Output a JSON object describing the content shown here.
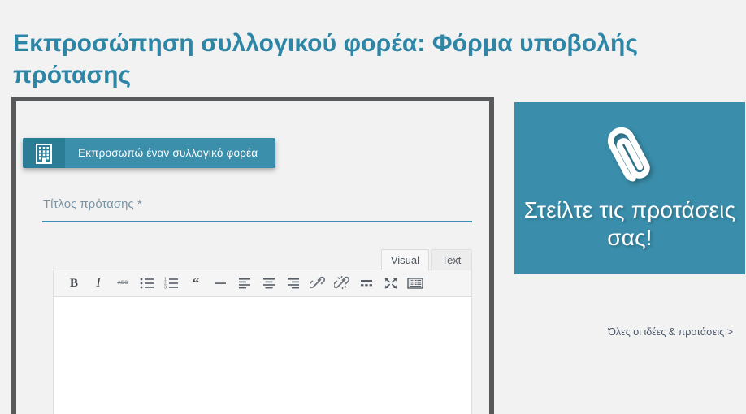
{
  "page": {
    "title": "Εκπροσώπηση συλλογικού φορέα: Φόρμα υποβολής πρότασης",
    "background_color": "#f2f2f2",
    "accent_color": "#3a8eab",
    "title_color": "#2e86a6"
  },
  "form": {
    "border_color": "#58595b",
    "tab": {
      "label": "Εκπροσωπώ έναν συλλογικό φορέα",
      "icon": "building-icon",
      "icon_cell_color": "#2b7c95",
      "label_cell_color": "#3c8fab",
      "selected": true
    },
    "title_input": {
      "placeholder": "Τίτλος πρότασης *",
      "value": "",
      "underline_color": "#3c8fab"
    },
    "editor": {
      "tabs": [
        {
          "label": "Visual",
          "active": true
        },
        {
          "label": "Text",
          "active": false
        }
      ],
      "toolbar": [
        {
          "name": "bold-icon",
          "label": "B"
        },
        {
          "name": "italic-icon",
          "label": "I"
        },
        {
          "name": "strikethrough-icon",
          "label": "ABC"
        },
        {
          "name": "bulleted-list-icon",
          "label": ""
        },
        {
          "name": "numbered-list-icon",
          "label": ""
        },
        {
          "name": "blockquote-icon",
          "label": ""
        },
        {
          "name": "horizontal-rule-icon",
          "label": ""
        },
        {
          "name": "align-left-icon",
          "label": ""
        },
        {
          "name": "align-center-icon",
          "label": ""
        },
        {
          "name": "align-right-icon",
          "label": ""
        },
        {
          "name": "insert-link-icon",
          "label": ""
        },
        {
          "name": "remove-link-icon",
          "label": ""
        },
        {
          "name": "insert-read-more-icon",
          "label": ""
        },
        {
          "name": "fullscreen-icon",
          "label": ""
        },
        {
          "name": "toolbar-toggle-icon",
          "label": ""
        }
      ],
      "content": ""
    }
  },
  "sidebar": {
    "cta": {
      "icon": "paperclip-icon",
      "text": "Στείλτε τις προτάσεις σας!",
      "background_color": "#3a8eab"
    },
    "all_ideas_link": "Όλες οι ιδέες & προτάσεις >"
  }
}
